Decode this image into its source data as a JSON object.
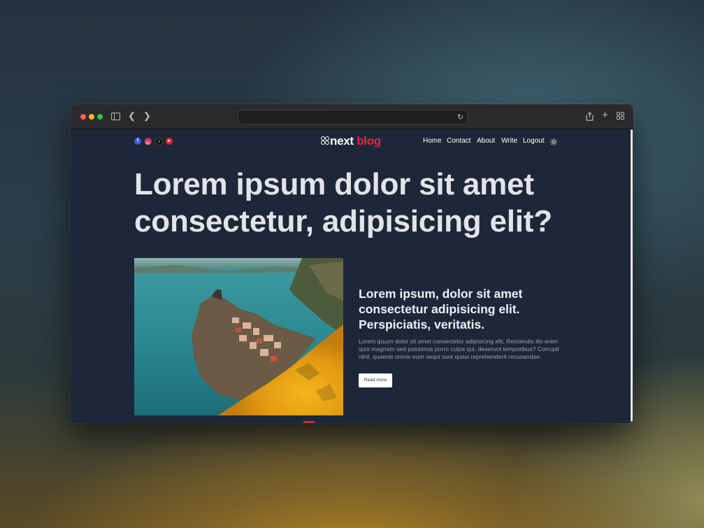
{
  "browser": {
    "url": "",
    "buttons": {
      "sidebar": "sidebar-icon",
      "back": "chevron-left-icon",
      "forward": "chevron-right-icon",
      "reload": "reload-icon",
      "share": "share-icon",
      "new_tab": "plus-icon",
      "tabs": "tab-overview-icon"
    }
  },
  "site": {
    "social": [
      "facebook-icon",
      "instagram-icon",
      "tiktok-icon",
      "youtube-icon"
    ],
    "logo": {
      "primary": "next",
      "accent": "blog"
    },
    "nav": [
      "Home",
      "Contact",
      "About",
      "Write",
      "Logout"
    ],
    "theme_toggle": "sun-icon"
  },
  "hero": {
    "title": "Lorem ipsum dolor sit amet consectetur, adipisicing elit?"
  },
  "featured": {
    "title": "Lorem ipsum, dolor sit amet consectetur adipisicing elit. Perspiciatis, veritatis.",
    "description": "Lorem ipsum dolor sit amet consectetur adipisicing elit. Reiciendis illo enim quis magnam sed possimus porro culpa qui, deserunt temporibus? Corrupti nihil, quaerat omnis eum sequi sunt quasi reprehenderit recusandae.",
    "button": "Read more"
  },
  "colors": {
    "page_bg": "#1e2739",
    "accent": "#e0253f",
    "text": "#e3e4e8"
  }
}
